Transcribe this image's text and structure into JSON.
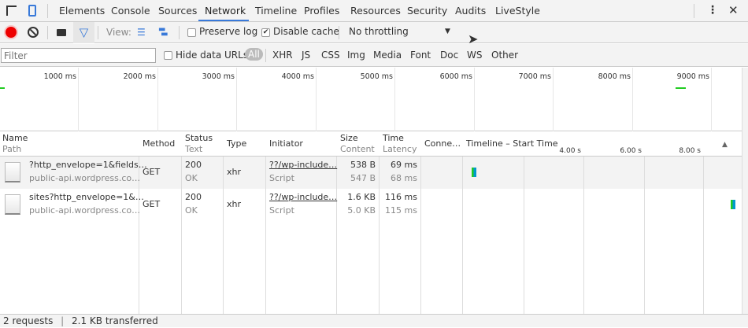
{
  "tabs": [
    "Elements",
    "Console",
    "Sources",
    "Network",
    "Timeline",
    "Profiles",
    "Resources",
    "Security",
    "Audits",
    "LiveStyle"
  ],
  "active_tab": "Network",
  "toolbar": {
    "view_label": "View:",
    "preserve_log": "Preserve log",
    "preserve_log_checked": false,
    "disable_cache": "Disable cache",
    "disable_cache_checked": true,
    "throttling": "No throttling"
  },
  "filter": {
    "placeholder": "Filter",
    "hide_data_urls": "Hide data URLs",
    "types": [
      "All",
      "XHR",
      "JS",
      "CSS",
      "Img",
      "Media",
      "Font",
      "Doc",
      "WS",
      "Other"
    ]
  },
  "overview_ticks": [
    "1000 ms",
    "2000 ms",
    "3000 ms",
    "4000 ms",
    "5000 ms",
    "6000 ms",
    "7000 ms",
    "8000 ms",
    "9000 ms"
  ],
  "columns": {
    "name": "Name",
    "path": "Path",
    "method": "Method",
    "status": "Status",
    "text": "Text",
    "type": "Type",
    "initiator": "Initiator",
    "size": "Size",
    "content": "Content",
    "time": "Time",
    "latency": "Latency",
    "connection": "Conne…",
    "timeline": "Timeline – Start Time",
    "timeline_ticks": [
      "4.00 s",
      "6.00 s",
      "8.00 s"
    ]
  },
  "rows": [
    {
      "name": "?http_envelope=1&fields…",
      "path": "public-api.wordpress.co…",
      "method": "GET",
      "status": "200",
      "status_text": "OK",
      "type": "xhr",
      "initiator": "??/wp-include…",
      "initiator_type": "Script",
      "size": "538 B",
      "content": "547 B",
      "time": "69 ms",
      "latency": "68 ms"
    },
    {
      "name": "sites?http_envelope=1&…",
      "path": "public-api.wordpress.co…",
      "method": "GET",
      "status": "200",
      "status_text": "OK",
      "type": "xhr",
      "initiator": "??/wp-include…",
      "initiator_type": "Script",
      "size": "1.6 KB",
      "content": "5.0 KB",
      "time": "116 ms",
      "latency": "115 ms"
    }
  ],
  "status": {
    "requests": "2 requests",
    "transferred": "2.1 KB transferred"
  }
}
